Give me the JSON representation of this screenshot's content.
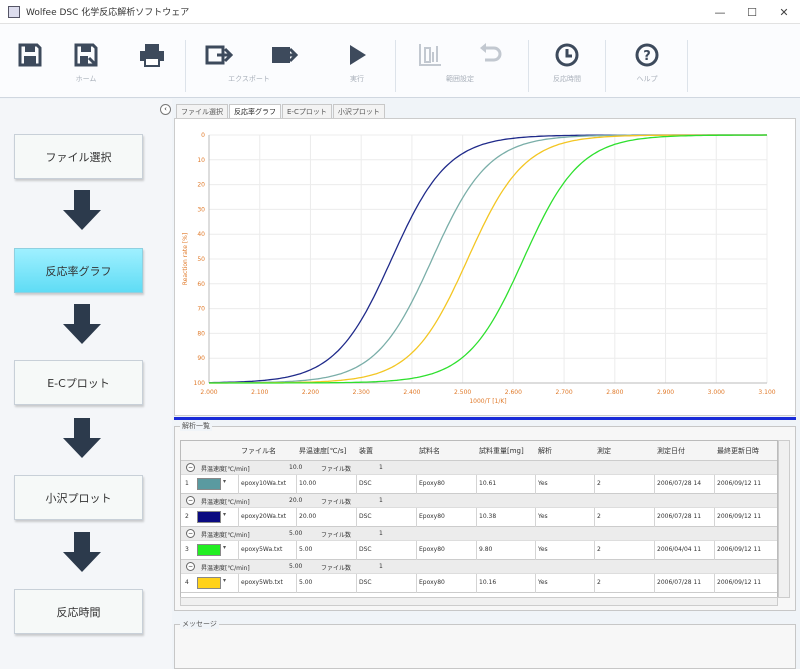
{
  "window": {
    "title": "Wolfee DSC 化学反応解析ソフトウェア",
    "minimize": "—",
    "maximize": "☐",
    "close": "✕"
  },
  "toolbar": {
    "items": [
      {
        "icon": "save-icon",
        "label": ""
      },
      {
        "icon": "save-as-icon",
        "label": "ホーム"
      },
      {
        "icon": "print-icon",
        "label": ""
      },
      {
        "icon": "export-icon",
        "label": ""
      },
      {
        "icon": "export-image-icon",
        "label": "エクスポート"
      },
      {
        "icon": "play-icon",
        "label": "実行"
      },
      {
        "icon": "chart-settings-icon",
        "label": ""
      },
      {
        "icon": "undo-icon",
        "label": "範囲設定"
      },
      {
        "icon": "clock-icon",
        "label": "反応時間"
      },
      {
        "icon": "help-icon",
        "label": "ヘルプ"
      }
    ]
  },
  "sidebar": {
    "steps": [
      "ファイル選択",
      "反応率グラフ",
      "E-Cプロット",
      "小沢プロット",
      "反応時間"
    ],
    "active": 1
  },
  "tabs": [
    "ファイル選択",
    "反応率グラフ",
    "E-Cプロット",
    "小沢プロット"
  ],
  "active_tab": 1,
  "chart_data": {
    "type": "line",
    "title": "",
    "xlabel": "1000/T [1/K]",
    "ylabel": "Reaction rate [%]",
    "x_ticks": [
      "2.000",
      "2.100",
      "2.200",
      "2.300",
      "2.400",
      "2.500",
      "2.600",
      "2.700",
      "2.800",
      "2.900",
      "3.000",
      "3.100"
    ],
    "y_ticks": [
      "0",
      "10",
      "20",
      "30",
      "40",
      "50",
      "60",
      "70",
      "80",
      "90",
      "100"
    ],
    "xlim": [
      2.0,
      3.1
    ],
    "ylim": [
      0,
      100
    ],
    "y_inverted": true,
    "grid": true,
    "series": [
      {
        "color": "#1f2a8a",
        "midpoint": 2.36,
        "steepness": 18
      },
      {
        "color": "#7aaea8",
        "midpoint": 2.44,
        "steepness": 18
      },
      {
        "color": "#f3c623",
        "midpoint": 2.51,
        "steepness": 18
      },
      {
        "color": "#2ee02e",
        "midpoint": 2.62,
        "steepness": 18
      }
    ]
  },
  "analysis_list": {
    "group_label": "解析一覧",
    "headers": [
      "ファイル名",
      "昇温速度[℃/s]",
      "装置",
      "試料名",
      "試料重量[mg]",
      "解析",
      "測定",
      "測定日付",
      "最終更新日時"
    ],
    "groups": [
      {
        "group_title": "昇温速度[℃/min]",
        "rate": "10.0",
        "count_label": "ファイル数",
        "count": "1",
        "row_no": "1",
        "swatch": "#5a9aa0",
        "file": "epoxy10Wa.txt",
        "rate_val": "10.00",
        "device": "DSC",
        "sample": "Epoxy80",
        "weight": "10.61",
        "analysis": "Yes",
        "measure": "2",
        "date": "2006/07/28 14",
        "updated": "2006/09/12 11"
      },
      {
        "group_title": "昇温速度[℃/min]",
        "rate": "20.0",
        "count_label": "ファイル数",
        "count": "1",
        "row_no": "2",
        "swatch": "#0a0a80",
        "file": "epoxy20Wa.txt",
        "rate_val": "20.00",
        "device": "DSC",
        "sample": "Epoxy80",
        "weight": "10.38",
        "analysis": "Yes",
        "measure": "2",
        "date": "2006/07/28 11",
        "updated": "2006/09/12 11"
      },
      {
        "group_title": "昇温速度[℃/min]",
        "rate": "5.00",
        "count_label": "ファイル数",
        "count": "1",
        "row_no": "3",
        "swatch": "#22ee22",
        "file": "epoxy5Wa.txt",
        "rate_val": "5.00",
        "device": "DSC",
        "sample": "Epoxy80",
        "weight": "9.80",
        "analysis": "Yes",
        "measure": "2",
        "date": "2006/04/04 11",
        "updated": "2006/09/12 11"
      },
      {
        "group_title": "昇温速度[℃/min]",
        "rate": "5.00",
        "count_label": "ファイル数",
        "count": "1",
        "row_no": "4",
        "swatch": "#ffd21a",
        "file": "epoxy5Wb.txt",
        "rate_val": "5.00",
        "device": "DSC",
        "sample": "Epoxy80",
        "weight": "10.16",
        "analysis": "Yes",
        "measure": "2",
        "date": "2006/07/28 11",
        "updated": "2006/09/12 11"
      }
    ]
  },
  "message": {
    "group_label": "メッセージ",
    "text": ""
  }
}
